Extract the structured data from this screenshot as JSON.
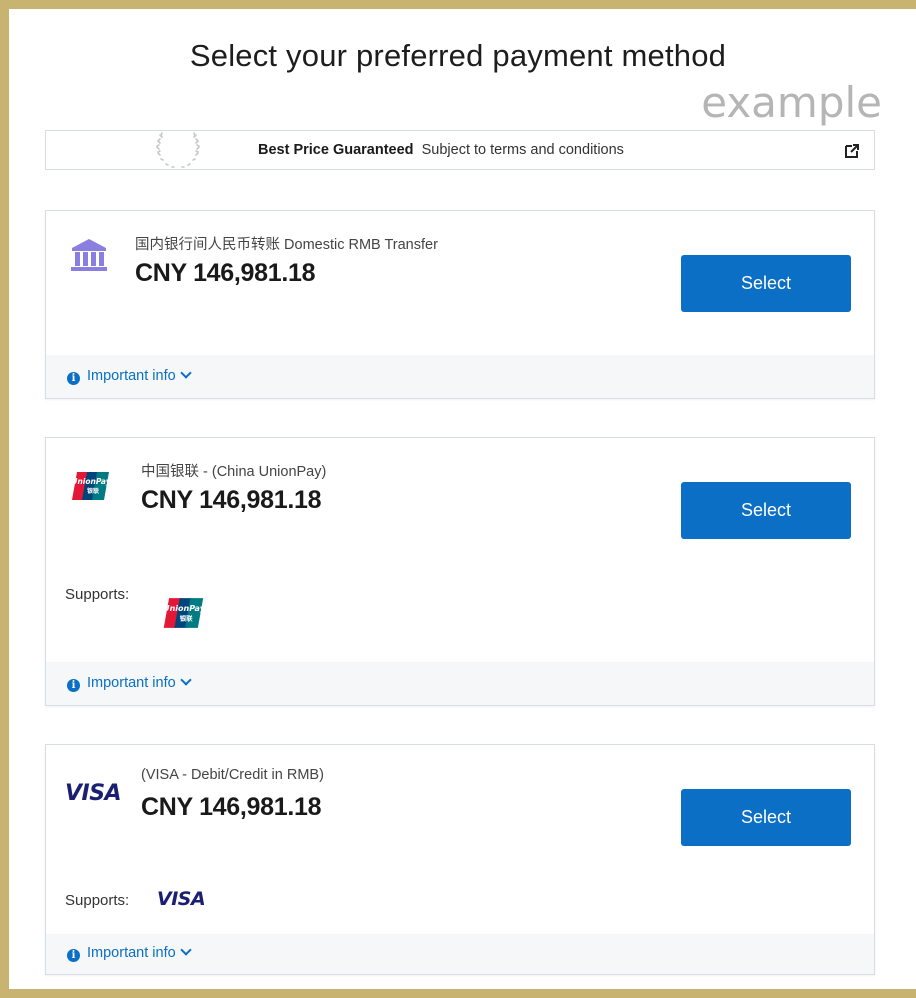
{
  "page": {
    "title": "Select your preferred payment method",
    "watermark": "example"
  },
  "banner": {
    "title": "Best Price Guaranteed",
    "subtitle": "Subject to terms and conditions"
  },
  "methods": [
    {
      "name": "国内银行间人民币转账 Domestic RMB Transfer",
      "amount": "CNY 146,981.18",
      "select_label": "Select",
      "info_label": "Important info",
      "icon": "bank-icon"
    },
    {
      "name": "中国银联 - (China UnionPay)",
      "amount": "CNY 146,981.18",
      "select_label": "Select",
      "supports_label": "Supports:",
      "info_label": "Important info",
      "icon": "unionpay-logo"
    },
    {
      "name": "(VISA - Debit/Credit in RMB)",
      "amount": "CNY 146,981.18",
      "select_label": "Select",
      "supports_label": "Supports:",
      "info_label": "Important info",
      "icon": "visa-logo"
    }
  ],
  "colors": {
    "accent": "#0a6fc5",
    "frame": "#c9b370",
    "bank_icon": "#8a7fe0"
  }
}
